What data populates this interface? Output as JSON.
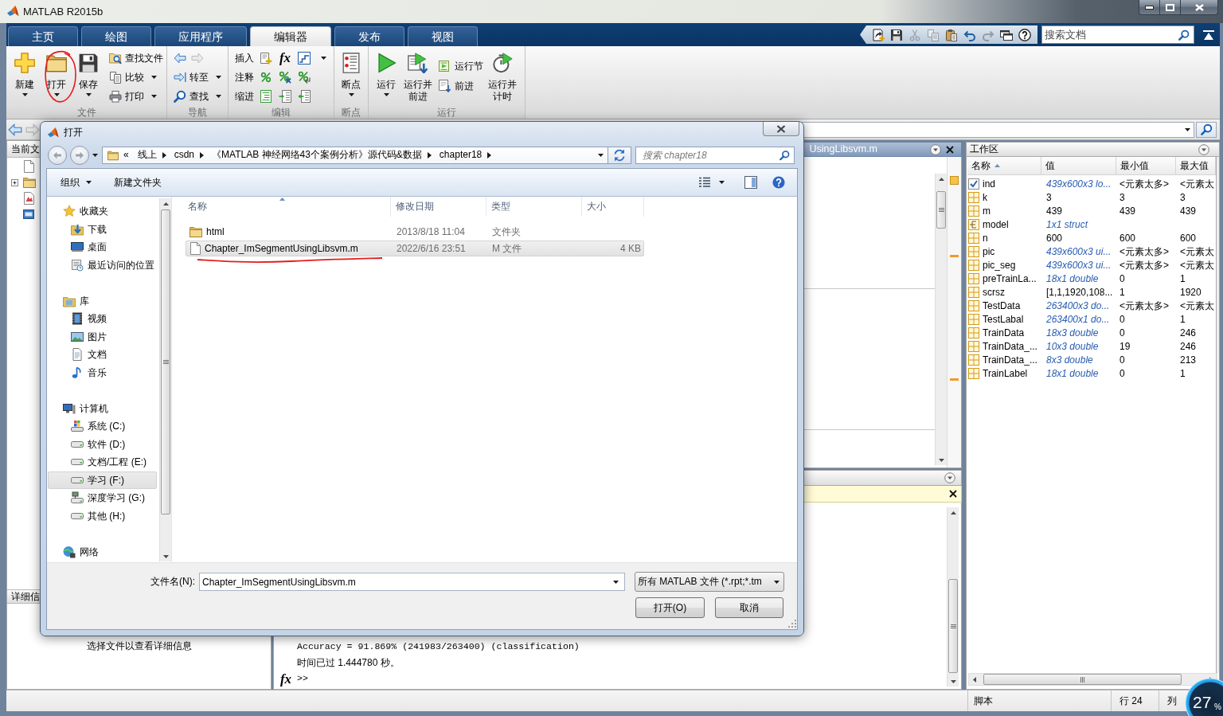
{
  "window": {
    "title": "MATLAB R2015b"
  },
  "ribbon_tabs": [
    {
      "label": "主页",
      "selected": false
    },
    {
      "label": "绘图",
      "selected": false
    },
    {
      "label": "应用程序",
      "selected": false
    },
    {
      "label": "编辑器",
      "selected": true
    },
    {
      "label": "发布",
      "selected": false
    },
    {
      "label": "视图",
      "selected": false
    }
  ],
  "quick_access": {
    "tools": [
      {
        "disabled": false
      },
      {
        "disabled": false
      },
      {
        "disabled": true
      },
      {
        "disabled": true
      },
      {
        "disabled": false
      },
      {
        "disabled": false
      },
      {
        "disabled": true
      },
      {
        "disabled": false
      },
      {
        "disabled": false
      }
    ],
    "search": {
      "placeholder": "搜索文档"
    }
  },
  "ribbon": {
    "groups": [
      {
        "title": "文件",
        "columns": [
          [
            {
              "kind": "large",
              "label": "新建",
              "menu": true
            }
          ],
          [
            {
              "kind": "large",
              "label": "打开",
              "menu": true
            }
          ],
          [
            {
              "kind": "large",
              "label": "保存",
              "menu": true
            }
          ],
          [
            {
              "kind": "small",
              "label": "查找文件",
              "menu": false
            },
            {
              "kind": "small",
              "label": "比较",
              "menu": true
            },
            {
              "kind": "small",
              "label": "打印",
              "menu": true
            }
          ]
        ]
      },
      {
        "title": "导航",
        "columns": [
          [
            {
              "kind": "arrows",
              "items": [
                {
                  "disabled": false
                },
                {
                  "disabled": true
                }
              ]
            },
            {
              "kind": "small",
              "label": "转至",
              "menu": true
            },
            {
              "kind": "small",
              "label": "查找",
              "menu": true
            }
          ]
        ]
      },
      {
        "title": "编辑",
        "columns": [
          [
            {
              "kind": "tools",
              "label": "插入",
              "symbol": "fx",
              "menu": true
            },
            {
              "kind": "tools",
              "label": "注释",
              "menu": false
            },
            {
              "kind": "tools",
              "label": "缩进",
              "menu": false
            }
          ]
        ]
      },
      {
        "title": "断点",
        "columns": [
          [
            {
              "kind": "large",
              "label": "断点",
              "menu": true
            }
          ]
        ]
      },
      {
        "title": "运行",
        "columns": [
          [
            {
              "kind": "large",
              "label": "运行",
              "menu": true
            }
          ],
          [
            {
              "kind": "large",
              "label": "运行并前进",
              "menu": false
            }
          ],
          [
            {
              "kind": "small",
              "label": "运行节",
              "menu": false
            },
            {
              "kind": "small",
              "label": "前进",
              "menu": false
            }
          ],
          [
            {
              "kind": "large",
              "label": "运行并计时",
              "menu": false
            }
          ]
        ]
      }
    ]
  },
  "path_bar": {
    "arrows": [
      {
        "disabled": false
      },
      {
        "disabled": true
      }
    ]
  },
  "current_folder": {
    "title": "当前文",
    "details_title": "详细信",
    "details_hint": "选择文件以查看详细信息"
  },
  "editor": {
    "title": "UsingLibsvm.m"
  },
  "command_window": {
    "lines": [
      "Accuracy = 91.869% (241983/263400) (classification)",
      "时间已过 1.444780 秒。"
    ],
    "function_button": "fx",
    "prompt": ">>"
  },
  "workspace": {
    "title": "工作区",
    "columns": [
      {
        "label": "名称",
        "sorted": true
      },
      {
        "label": "值",
        "sorted": false
      },
      {
        "label": "最小值",
        "sorted": false
      },
      {
        "label": "最大值",
        "sorted": false
      }
    ],
    "rows": [
      {
        "kind": "logical",
        "name": "ind",
        "value": "439x600x3 lo...",
        "summary": true,
        "min": "<元素太多>",
        "max": "<元素太"
      },
      {
        "kind": "matrix",
        "name": "k",
        "value": "3",
        "summary": false,
        "min": "3",
        "max": "3"
      },
      {
        "kind": "matrix",
        "name": "m",
        "value": "439",
        "summary": false,
        "min": "439",
        "max": "439"
      },
      {
        "kind": "struct",
        "name": "model",
        "value": "1x1 struct",
        "summary": true
      },
      {
        "kind": "matrix",
        "name": "n",
        "value": "600",
        "summary": false,
        "min": "600",
        "max": "600"
      },
      {
        "kind": "matrix",
        "name": "pic",
        "value": "439x600x3 ui...",
        "summary": true,
        "min": "<元素太多>",
        "max": "<元素太"
      },
      {
        "kind": "matrix",
        "name": "pic_seg",
        "value": "439x600x3 ui...",
        "summary": true,
        "min": "<元素太多>",
        "max": "<元素太"
      },
      {
        "kind": "matrix",
        "name": "preTrainLa...",
        "value": "18x1 double",
        "summary": true,
        "min": "0",
        "max": "1"
      },
      {
        "kind": "matrix",
        "name": "scrsz",
        "value": "[1,1,1920,108...",
        "summary": false,
        "min": "1",
        "max": "1920"
      },
      {
        "kind": "matrix",
        "name": "TestData",
        "value": "263400x3 do...",
        "summary": true,
        "min": "<元素太多>",
        "max": "<元素太"
      },
      {
        "kind": "matrix",
        "name": "TestLabal",
        "value": "263400x1 do...",
        "summary": true,
        "min": "0",
        "max": "1"
      },
      {
        "kind": "matrix",
        "name": "TrainData",
        "value": "18x3 double",
        "summary": true,
        "min": "0",
        "max": "246"
      },
      {
        "kind": "matrix",
        "name": "TrainData_...",
        "value": "10x3 double",
        "summary": true,
        "min": "19",
        "max": "246"
      },
      {
        "kind": "matrix",
        "name": "TrainData_...",
        "value": "8x3 double",
        "summary": true,
        "min": "0",
        "max": "213"
      },
      {
        "kind": "matrix",
        "name": "TrainLabel",
        "value": "18x1 double",
        "summary": true,
        "min": "0",
        "max": "1"
      }
    ]
  },
  "status_bar": {
    "items": [
      "脚本",
      "行 24",
      "列"
    ]
  },
  "dialog": {
    "title": "打开",
    "address": {
      "overflow": "«",
      "segments": [
        "线上",
        "csdn",
        "《MATLAB 神经网络43个案例分析》源代码&数据",
        "chapter18"
      ]
    },
    "search": {
      "placeholder": "搜索 chapter18"
    },
    "toolbar": [
      {
        "label": "组织",
        "menu": true
      },
      {
        "label": "新建文件夹",
        "menu": false
      }
    ],
    "nav": [
      {
        "label": "收藏夹",
        "selected": false,
        "children": [
          {
            "label": "下载",
            "selected": false
          },
          {
            "label": "桌面",
            "selected": false
          },
          {
            "label": "最近访问的位置",
            "selected": false
          }
        ]
      },
      {
        "label": "库",
        "selected": false,
        "children": [
          {
            "label": "视频",
            "selected": false
          },
          {
            "label": "图片",
            "selected": false
          },
          {
            "label": "文档",
            "selected": false
          },
          {
            "label": "音乐",
            "selected": false
          }
        ]
      },
      {
        "label": "计算机",
        "selected": false,
        "children": [
          {
            "label": "系统 (C:)",
            "selected": false
          },
          {
            "label": "软件 (D:)",
            "selected": false
          },
          {
            "label": "文档/工程 (E:)",
            "selected": false
          },
          {
            "label": "学习 (F:)",
            "selected": true
          },
          {
            "label": "深度学习 (G:)",
            "selected": false
          },
          {
            "label": "其他 (H:)",
            "selected": false
          }
        ]
      },
      {
        "label": "网络",
        "selected": false
      }
    ],
    "columns": [
      {
        "label": "名称",
        "sorted": true
      },
      {
        "label": "修改日期",
        "sorted": false
      },
      {
        "label": "类型",
        "sorted": false
      },
      {
        "label": "大小",
        "sorted": false
      }
    ],
    "files": [
      {
        "kind": "folder",
        "name": "html",
        "modified": "2013/8/18 11:04",
        "type": "文件夹",
        "selected": false
      },
      {
        "kind": "file",
        "name": "Chapter_ImSegmentUsingLibsvm.m",
        "modified": "2022/6/16 23:51",
        "type": "M 文件",
        "size": "4 KB",
        "selected": true
      }
    ],
    "file_name": {
      "label": "文件名(N):",
      "value": "Chapter_ImSegmentUsingLibsvm.m"
    },
    "file_type": {
      "value": "所有 MATLAB 文件 (*.rpt;*.tm"
    },
    "buttons": [
      "打开(O)",
      "取消"
    ]
  },
  "overlay_widget": {
    "value": "27",
    "unit": "%"
  }
}
